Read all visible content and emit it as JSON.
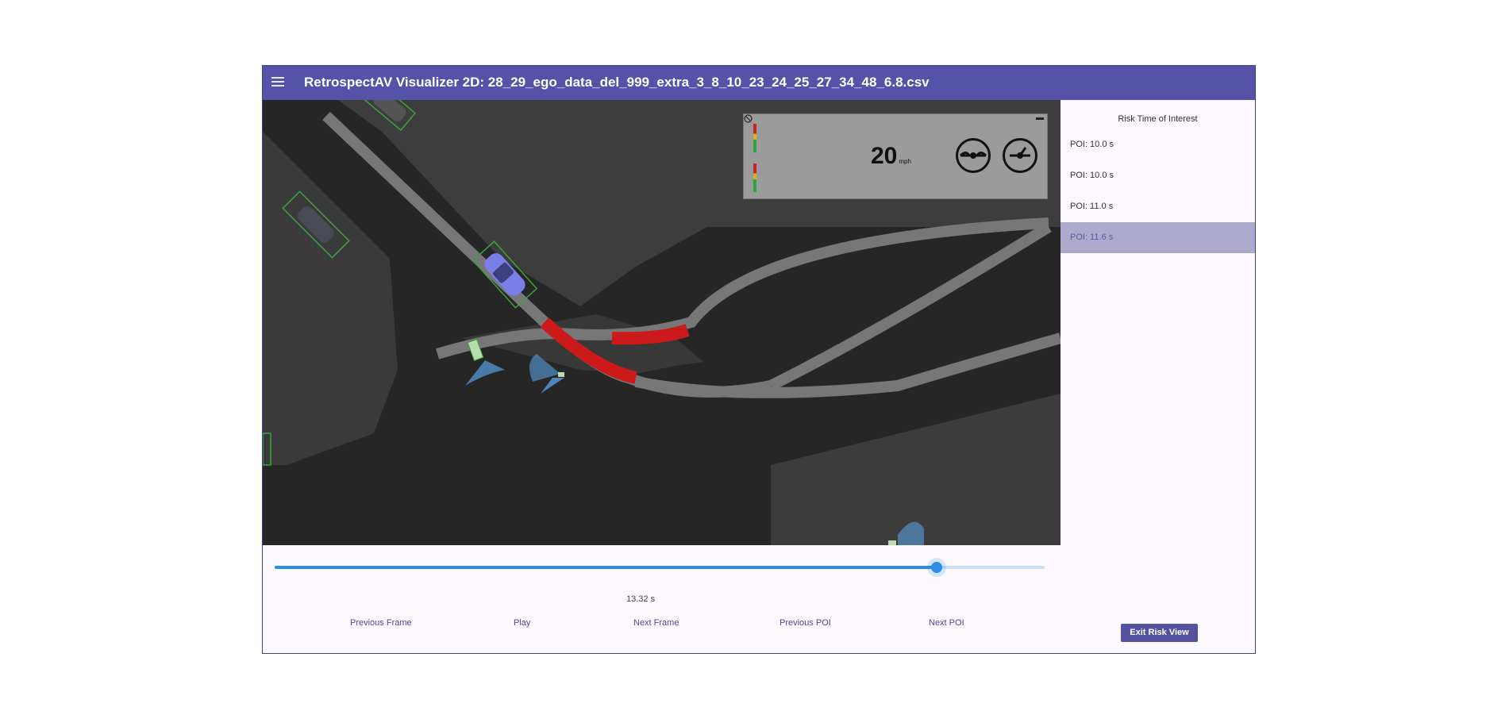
{
  "app": {
    "title": "RetrospectAV Visualizer 2D: 28_29_ego_data_del_999_extra_3_8_10_23_24_25_27_34_48_6.8.csv",
    "menu_icon": "hamburger-menu-icon",
    "accent_color": "#5552a8"
  },
  "hud": {
    "speed_value": "20",
    "speed_unit": "mph",
    "icons": [
      "minimize-icon",
      "steering-wheel-icon",
      "speedometer-icon",
      "close-circle-icon"
    ]
  },
  "sidebar": {
    "title": "Risk Time of Interest",
    "items": [
      {
        "label": "POI: 10.0 s",
        "selected": false
      },
      {
        "label": "POI: 10.0 s",
        "selected": false
      },
      {
        "label": "POI: 11.0 s",
        "selected": false
      },
      {
        "label": "POI: 11.6 s",
        "selected": true
      }
    ],
    "exit_button": "Exit Risk View"
  },
  "timeline": {
    "progress": 0.86,
    "time_label": "13.32 s"
  },
  "controls": {
    "previous_frame": "Previous Frame",
    "play": "Play",
    "next_frame": "Next Frame",
    "previous_poi": "Previous POI",
    "next_poi": "Next POI"
  },
  "colors": {
    "risk_path": "#cc1a1a",
    "path": "#777777",
    "ego_vehicle": "#7a7fe6",
    "bounding_box": "#3aa43a",
    "slider": "#2e8ee5"
  }
}
